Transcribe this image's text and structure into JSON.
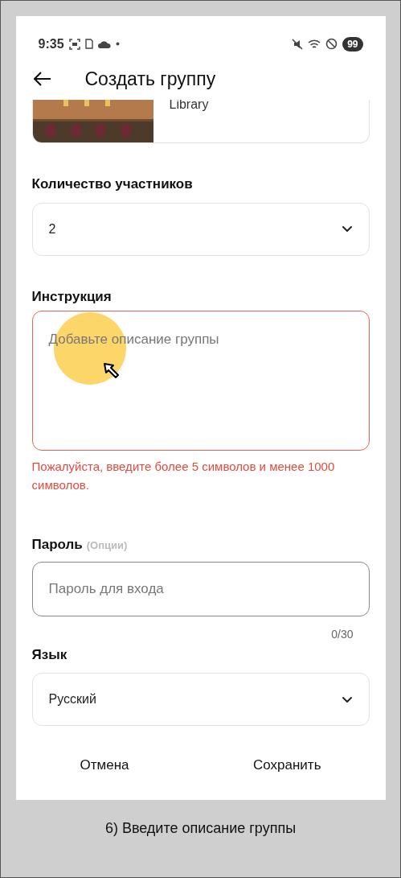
{
  "status_bar": {
    "time": "9:35",
    "battery": "99"
  },
  "header": {
    "title": "Создать группу"
  },
  "room_card": {
    "name": "Library"
  },
  "members": {
    "label": "Количество участников",
    "value": "2"
  },
  "instruction": {
    "label": "Инструкция",
    "placeholder": "Добавьте описание группы",
    "error": true,
    "error_text": "Пожалуйста, введите более 5 символов и менее 1000 символов."
  },
  "password": {
    "label": "Пароль",
    "hint": "(Опции)",
    "placeholder": "Пароль для входа",
    "counter": "0/30"
  },
  "language": {
    "label": "Язык",
    "value": "Русский"
  },
  "buttons": [
    "Отмена",
    "Сохранить"
  ],
  "caption": "6) Введите описание группы"
}
